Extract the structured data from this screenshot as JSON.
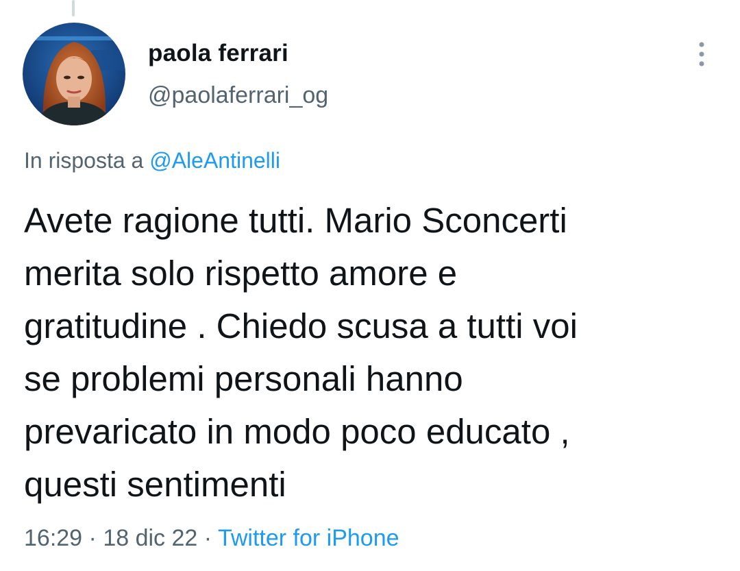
{
  "author": {
    "display_name": "paola ferrari",
    "handle": "@paolaferrari_og"
  },
  "icons": {
    "more": "more-vertical-icon"
  },
  "reply": {
    "prefix": "In risposta a",
    "to_handle": "@AleAntinelli"
  },
  "tweet": {
    "lines": [
      "Avete ragione tutti. Mario Sconcerti",
      "merita solo rispetto amore e",
      "gratitudine . Chiedo scusa a tutti voi",
      "se problemi personali hanno",
      "prevaricato in modo poco educato ,",
      "questi sentimenti"
    ]
  },
  "meta": {
    "time": "16:29",
    "separator": "·",
    "date": "18 dic 22",
    "source": "Twitter for iPhone"
  },
  "colors": {
    "text_primary": "#0f1419",
    "text_secondary": "#536471",
    "link": "#1d9bf0",
    "thread_line": "#cfd9de"
  }
}
